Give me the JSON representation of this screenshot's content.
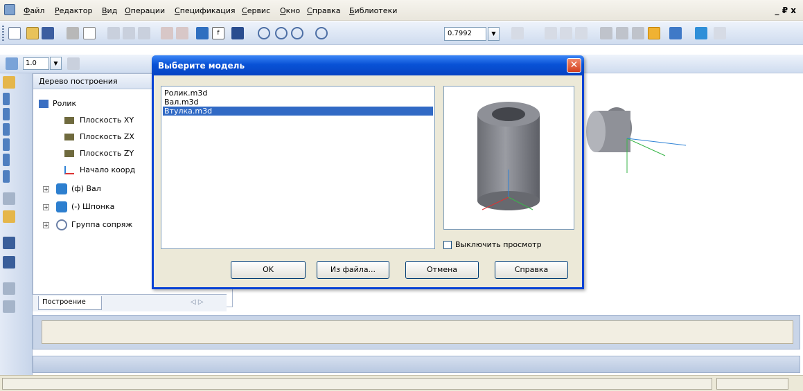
{
  "menu": {
    "items": [
      "Файл",
      "Редактор",
      "Вид",
      "Операции",
      "Спецификация",
      "Сервис",
      "Окно",
      "Справка",
      "Библиотеки"
    ]
  },
  "window_controls": "_ ₽ x",
  "toolbar": {
    "zoom_value": "0.7992",
    "scale_value": "1.0"
  },
  "tree": {
    "header": "Дерево построения",
    "root": "Ролик",
    "items": [
      "Плоскость XY",
      "Плоскость ZX",
      "Плоскость ZY",
      "Начало коорд",
      "(ф) Вал",
      "(-) Шпонка",
      "Группа сопряж"
    ],
    "tab_label": "Построение"
  },
  "dialog": {
    "title": "Выберите модель",
    "files": [
      "Ролик.m3d",
      "Вал.m3d",
      "Втулка.m3d"
    ],
    "selected_index": 2,
    "preview_checkbox": "Выключить просмотр",
    "buttons": {
      "ok": "OK",
      "from_file": "Из файла...",
      "cancel": "Отмена",
      "help": "Справка"
    }
  },
  "colors": {
    "title_bar": "#0952d6",
    "selection": "#316ac5",
    "close_button": "#d3411f"
  }
}
